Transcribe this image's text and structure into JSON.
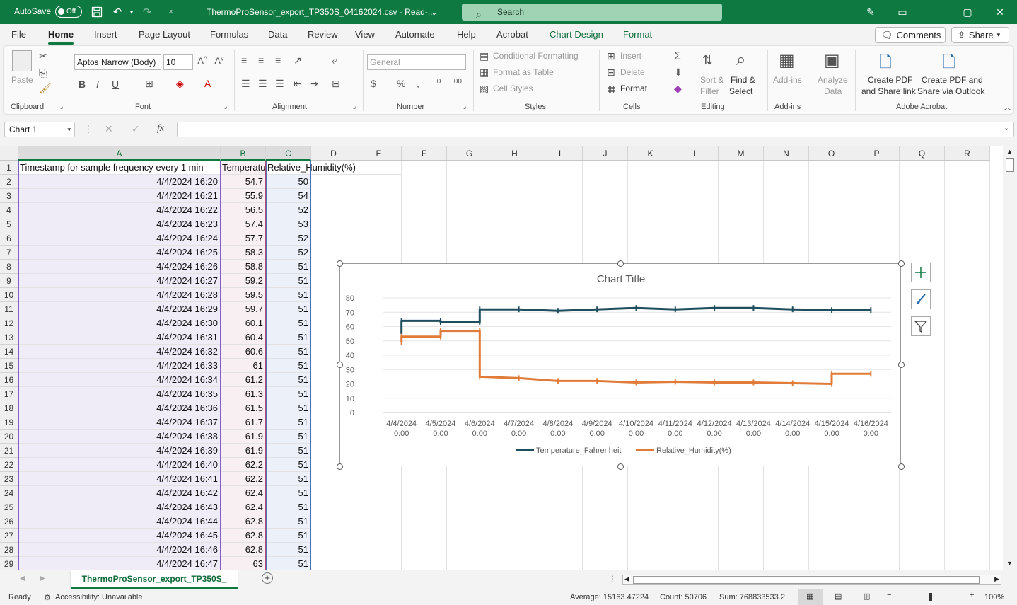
{
  "titlebar": {
    "autosave_label": "AutoSave",
    "autosave_state": "Off",
    "document_title": "ThermoProSensor_export_TP350S_04162024.csv - Read-...",
    "search_placeholder": "Search"
  },
  "ribbon_tabs": [
    "File",
    "Home",
    "Insert",
    "Page Layout",
    "Formulas",
    "Data",
    "Review",
    "View",
    "Automate",
    "Help",
    "Acrobat",
    "Chart Design",
    "Format"
  ],
  "top_buttons": {
    "comments": "Comments",
    "share": "Share"
  },
  "ribbon": {
    "clipboard": {
      "label": "Clipboard",
      "paste": "Paste"
    },
    "font": {
      "label": "Font",
      "font_name": "Aptos Narrow (Body)",
      "font_size": "10"
    },
    "alignment": {
      "label": "Alignment"
    },
    "number": {
      "label": "Number",
      "format": "General"
    },
    "styles": {
      "label": "Styles",
      "conditional": "Conditional Formatting",
      "format_table": "Format as Table",
      "cell_styles": "Cell Styles"
    },
    "cells": {
      "label": "Cells",
      "insert": "Insert",
      "delete": "Delete",
      "format": "Format"
    },
    "editing": {
      "label": "Editing",
      "sort_filter_1": "Sort &",
      "sort_filter_2": "Filter",
      "find_select_1": "Find &",
      "find_select_2": "Select"
    },
    "addins": {
      "label": "Add-ins",
      "addins": "Add-ins",
      "analyze_1": "Analyze",
      "analyze_2": "Data"
    },
    "acrobat": {
      "label": "Adobe Acrobat",
      "create_pdf_link_1": "Create PDF",
      "create_pdf_link_2": "and Share link",
      "create_pdf_outlook_1": "Create PDF and",
      "create_pdf_outlook_2": "Share via Outlook"
    }
  },
  "formula_bar": {
    "name_box": "Chart 1",
    "fx": "fx",
    "formula": ""
  },
  "columns": [
    "A",
    "B",
    "C",
    "D",
    "E",
    "F",
    "G",
    "H",
    "I",
    "J",
    "K",
    "L",
    "M",
    "N",
    "O",
    "P",
    "Q",
    "R"
  ],
  "header_row": {
    "a": "Timestamp for sample frequency every 1 min",
    "b": "Temperature_Fahrenheit",
    "c": "Relative_Humidity(%)"
  },
  "rows": [
    [
      "4/4/2024 16:20",
      "54.7",
      "50"
    ],
    [
      "4/4/2024 16:21",
      "55.9",
      "54"
    ],
    [
      "4/4/2024 16:22",
      "56.5",
      "52"
    ],
    [
      "4/4/2024 16:23",
      "57.4",
      "53"
    ],
    [
      "4/4/2024 16:24",
      "57.7",
      "52"
    ],
    [
      "4/4/2024 16:25",
      "58.3",
      "52"
    ],
    [
      "4/4/2024 16:26",
      "58.8",
      "51"
    ],
    [
      "4/4/2024 16:27",
      "59.2",
      "51"
    ],
    [
      "4/4/2024 16:28",
      "59.5",
      "51"
    ],
    [
      "4/4/2024 16:29",
      "59.7",
      "51"
    ],
    [
      "4/4/2024 16:30",
      "60.1",
      "51"
    ],
    [
      "4/4/2024 16:31",
      "60.4",
      "51"
    ],
    [
      "4/4/2024 16:32",
      "60.6",
      "51"
    ],
    [
      "4/4/2024 16:33",
      "61",
      "51"
    ],
    [
      "4/4/2024 16:34",
      "61.2",
      "51"
    ],
    [
      "4/4/2024 16:35",
      "61.3",
      "51"
    ],
    [
      "4/4/2024 16:36",
      "61.5",
      "51"
    ],
    [
      "4/4/2024 16:37",
      "61.7",
      "51"
    ],
    [
      "4/4/2024 16:38",
      "61.9",
      "51"
    ],
    [
      "4/4/2024 16:39",
      "61.9",
      "51"
    ],
    [
      "4/4/2024 16:40",
      "62.2",
      "51"
    ],
    [
      "4/4/2024 16:41",
      "62.2",
      "51"
    ],
    [
      "4/4/2024 16:42",
      "62.4",
      "51"
    ],
    [
      "4/4/2024 16:43",
      "62.4",
      "51"
    ],
    [
      "4/4/2024 16:44",
      "62.8",
      "51"
    ],
    [
      "4/4/2024 16:45",
      "62.8",
      "51"
    ],
    [
      "4/4/2024 16:46",
      "62.8",
      "51"
    ],
    [
      "4/4/2024 16:47",
      "63",
      "51"
    ]
  ],
  "chart_data": {
    "type": "line",
    "title": "Chart Title",
    "categories": [
      "4/4/2024 0:00",
      "4/5/2024 0:00",
      "4/6/2024 0:00",
      "4/7/2024 0:00",
      "4/8/2024 0:00",
      "4/9/2024 0:00",
      "4/10/2024 0:00",
      "4/11/2024 0:00",
      "4/12/2024 0:00",
      "4/13/2024 0:00",
      "4/14/2024 0:00",
      "4/15/2024 0:00",
      "4/16/2024 0:00"
    ],
    "ylim": [
      0,
      80
    ],
    "yticks": [
      0,
      10,
      20,
      30,
      40,
      50,
      60,
      70,
      80
    ],
    "grid": true,
    "legend": "bottom",
    "series": [
      {
        "name": "Temperature_Fahrenheit",
        "color": "#1f4e5f",
        "points": [
          [
            0,
            55
          ],
          [
            0,
            64
          ],
          [
            1,
            64
          ],
          [
            1,
            63
          ],
          [
            2,
            63
          ],
          [
            2,
            72
          ],
          [
            3,
            72
          ],
          [
            4,
            71
          ],
          [
            5,
            72
          ],
          [
            6,
            73
          ],
          [
            7,
            72
          ],
          [
            8,
            73
          ],
          [
            9,
            73
          ],
          [
            10,
            72
          ],
          [
            11,
            71.5
          ],
          [
            12,
            71.5
          ]
        ]
      },
      {
        "name": "Relative_Humidity(%)",
        "color": "#e07b39",
        "points": [
          [
            0,
            49
          ],
          [
            0,
            53
          ],
          [
            1,
            53
          ],
          [
            1,
            57
          ],
          [
            2,
            57
          ],
          [
            2,
            25
          ],
          [
            3,
            24
          ],
          [
            4,
            22
          ],
          [
            5,
            22
          ],
          [
            6,
            21
          ],
          [
            7,
            21.5
          ],
          [
            8,
            21
          ],
          [
            9,
            21
          ],
          [
            10,
            20.5
          ],
          [
            11,
            20
          ],
          [
            11,
            27
          ],
          [
            12,
            27
          ]
        ]
      }
    ]
  },
  "sheet_tab": "ThermoProSensor_export_TP350S_",
  "status": {
    "ready": "Ready",
    "accessibility": "Accessibility: Unavailable",
    "average": "Average: 15163.47224",
    "count": "Count: 50706",
    "sum": "Sum: 768833533.2",
    "zoom": "100%"
  }
}
